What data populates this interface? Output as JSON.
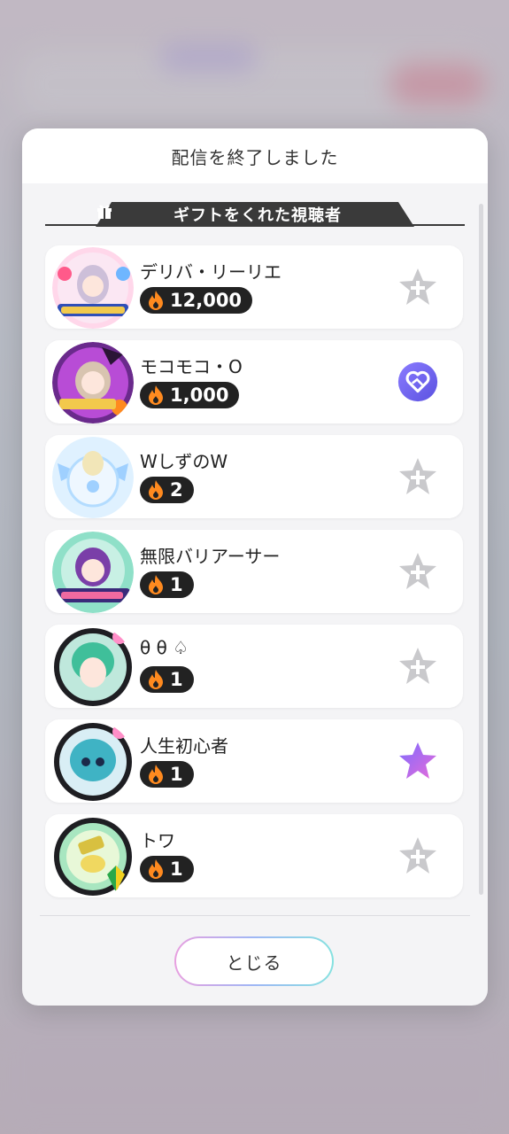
{
  "modal": {
    "title": "配信を終了しました",
    "section_title": "ギフトをくれた視聴者",
    "close_label": "とじる"
  },
  "colors": {
    "pill_bg": "#222222",
    "flame": "#ff8a1f",
    "star_inactive": "#c9c9cc",
    "star_active_gradient": [
      "#7d6bff",
      "#e86bd9"
    ],
    "partner_badge": "#6a63f0"
  },
  "viewers": [
    {
      "name": "デリバ・リーリエ",
      "gift_count": "12,000",
      "action_icon": "add-favorite-icon",
      "avatar_icon": "anniversary-avatar-icon"
    },
    {
      "name": "モコモコ・O",
      "gift_count": "1,000",
      "action_icon": "partner-heart-icon",
      "avatar_icon": "halloween-avatar-icon"
    },
    {
      "name": "WしずのW",
      "gift_count": "2",
      "action_icon": "add-favorite-icon",
      "avatar_icon": "winged-avatar-icon"
    },
    {
      "name": "無限バリアーサー",
      "gift_count": "1",
      "action_icon": "add-favorite-icon",
      "avatar_icon": "festival-avatar-icon"
    },
    {
      "name": "θ θ ♤",
      "gift_count": "1",
      "action_icon": "add-favorite-icon",
      "avatar_icon": "green-hair-avatar-icon"
    },
    {
      "name": "人生初心者",
      "gift_count": "1",
      "action_icon": "favorited-star-icon",
      "avatar_icon": "blue-character-avatar-icon"
    },
    {
      "name": "トワ",
      "gift_count": "1",
      "action_icon": "add-favorite-icon",
      "avatar_icon": "beginner-avatar-icon"
    }
  ]
}
